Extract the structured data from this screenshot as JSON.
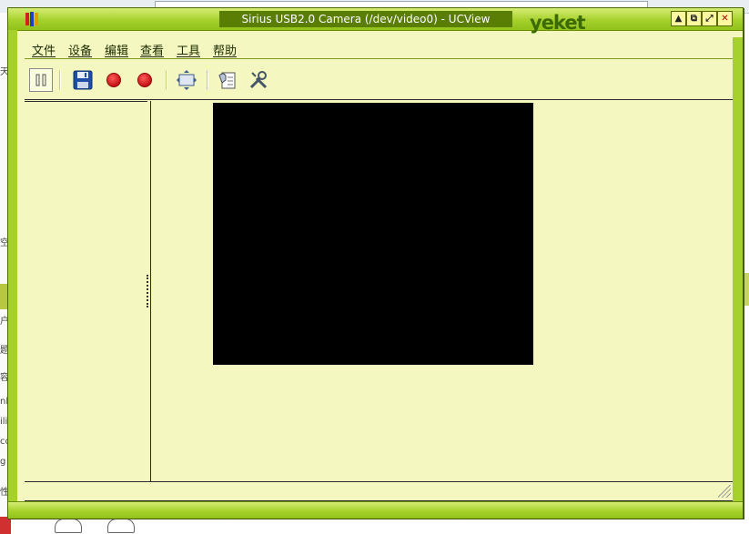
{
  "window": {
    "title": "Sirius USB2.0 Camera (/dev/video0) - UCView",
    "logo": "yeket",
    "controls": [
      "minimize",
      "restore",
      "maximize",
      "close"
    ],
    "accent": "#a6d12c",
    "background": "#f4f8c0"
  },
  "menu": {
    "items": [
      "文件",
      "设备",
      "编辑",
      "查看",
      "工具",
      "帮助"
    ]
  },
  "toolbar": {
    "buttons": [
      {
        "icon": "pause-icon",
        "state": "pressed"
      },
      {
        "icon": "save-icon"
      },
      {
        "icon": "record-icon"
      },
      {
        "icon": "record-icon"
      },
      {
        "icon": "fit-window-icon"
      },
      {
        "icon": "properties-icon"
      },
      {
        "icon": "tools-icon"
      }
    ]
  },
  "video": {
    "color": "#000000"
  }
}
